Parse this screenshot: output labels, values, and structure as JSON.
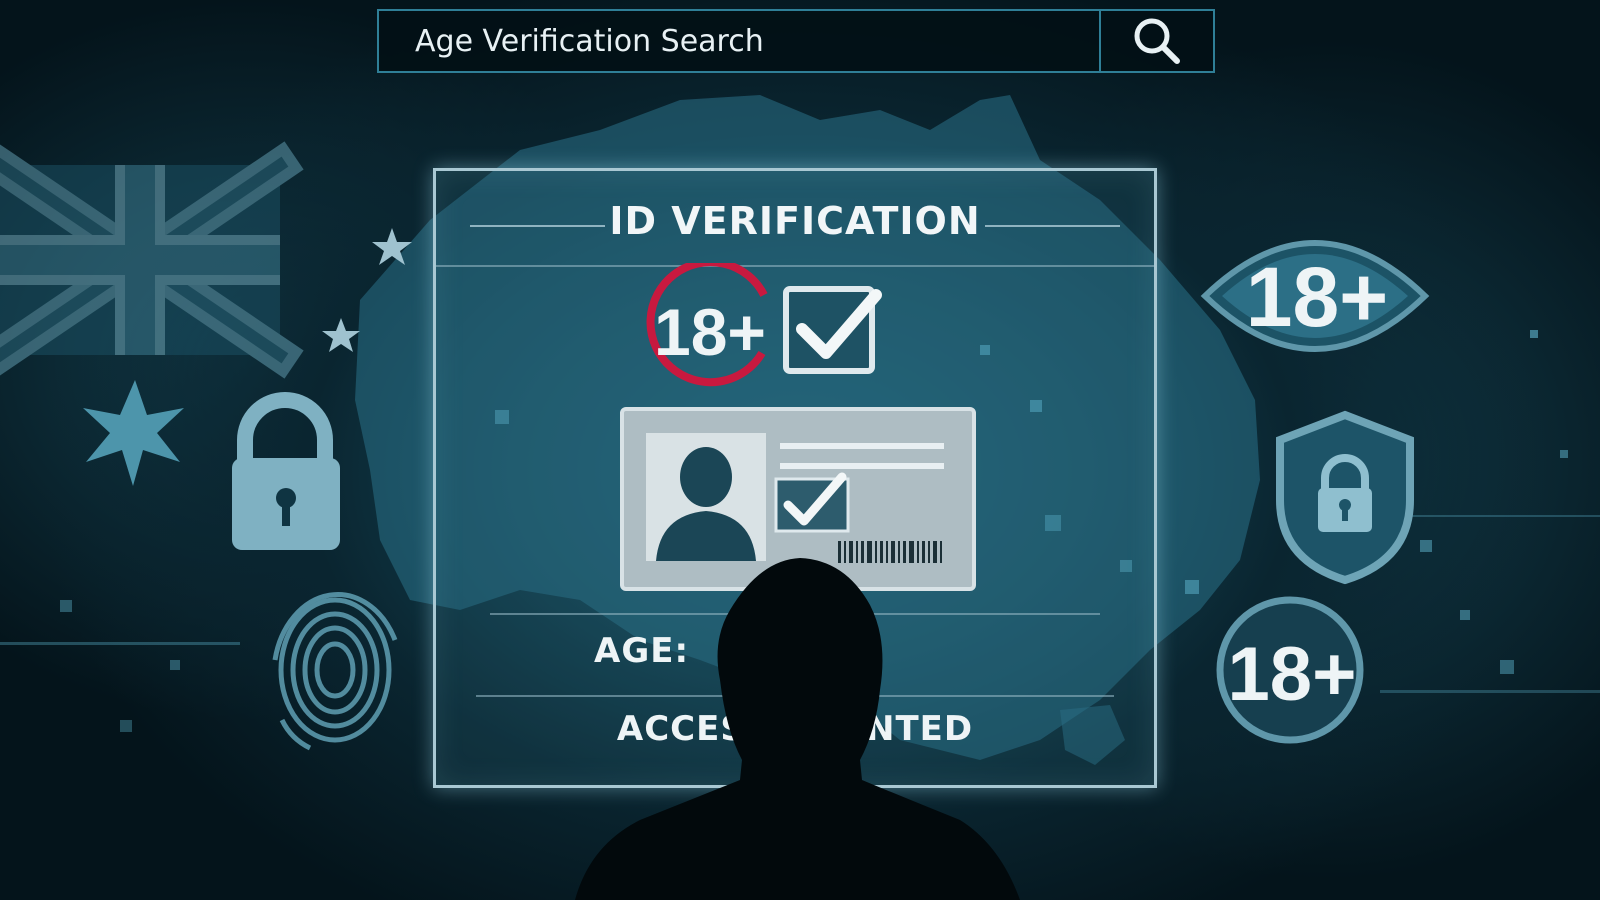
{
  "search": {
    "value": "Age Verification Search",
    "icon": "search-icon"
  },
  "panel": {
    "title": "ID VERIFICATION",
    "age_badge": "18+",
    "age_label": "AGE:",
    "access_text": "ACCESS GRANTED"
  },
  "side_badges": {
    "eye_badge": "18+",
    "circle_badge": "18+"
  },
  "icons": [
    "union-jack-flag",
    "star-icon",
    "padlock-icon",
    "fingerprint-icon",
    "eye-icon",
    "shield-lock-icon",
    "checkbox-icon",
    "id-card-icon",
    "barcode-icon",
    "person-silhouette"
  ],
  "colors": {
    "accent_red": "#c8193f",
    "panel_glow": "#a9c8d3",
    "background": "#04141b"
  }
}
